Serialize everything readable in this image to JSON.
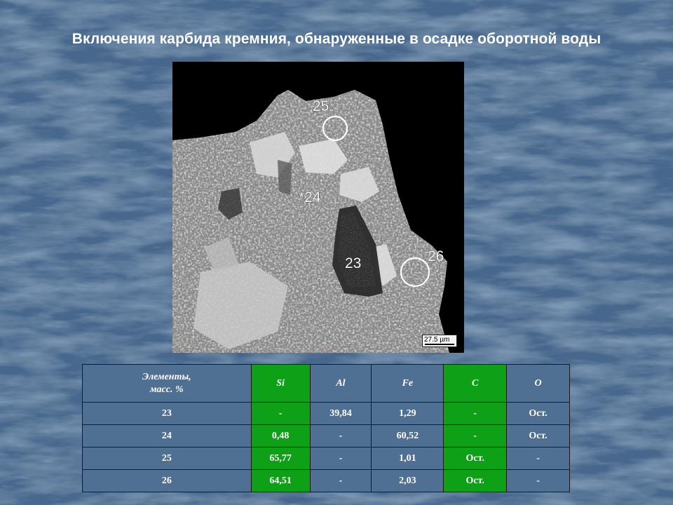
{
  "slide": {
    "title": "Включения карбида кремния, обнаруженные в осадке оборотной воды",
    "background_color": "#4a6a8e"
  },
  "micrograph": {
    "labels": [
      "25",
      "*24",
      "23",
      "26"
    ],
    "scale_bar": "27.5 µm"
  },
  "table": {
    "header_line1": "Элементы,",
    "header_line2": "масс. %",
    "columns": [
      "Si",
      "Al",
      "Fe",
      "C",
      "O"
    ],
    "highlight_color": "#0ea016",
    "rows": [
      {
        "id": "23",
        "values": [
          "-",
          "39,84",
          "1,29",
          "-",
          "Ост."
        ]
      },
      {
        "id": "24",
        "values": [
          "0,48",
          "-",
          "60,52",
          "-",
          "Ост."
        ]
      },
      {
        "id": "25",
        "values": [
          "65,77",
          "-",
          "1,01",
          "Ост.",
          "-"
        ]
      },
      {
        "id": "26",
        "values": [
          "64,51",
          "-",
          "2,03",
          "Ост.",
          "-"
        ]
      }
    ]
  }
}
